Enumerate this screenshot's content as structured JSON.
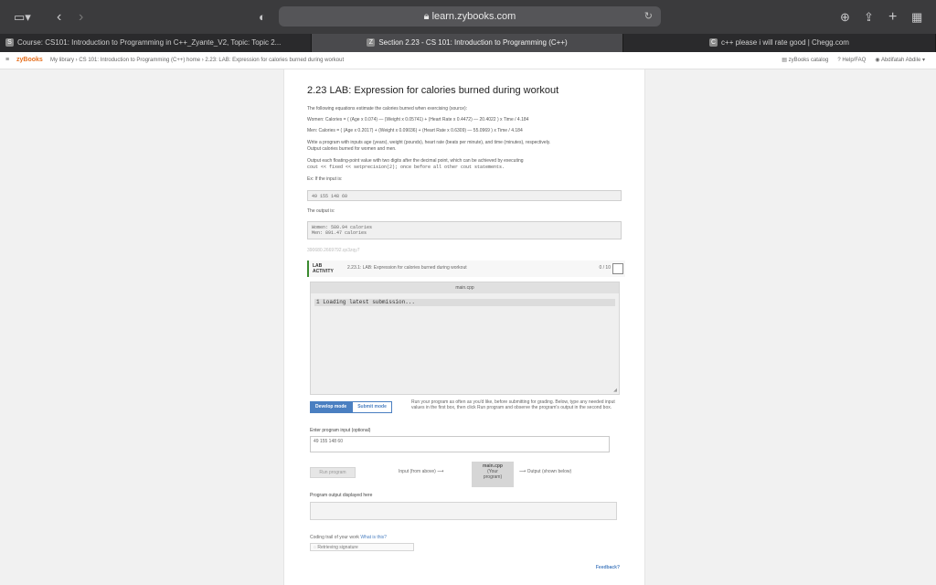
{
  "browser": {
    "address": "learn.zybooks.com",
    "tabs": [
      {
        "favicon": "S",
        "title": "Course: CS101: Introduction to Programming in C++_Zyante_V2, Topic: Topic 2..."
      },
      {
        "favicon": "Z",
        "title": "Section 2.23 - CS 101: Introduction to Programming (C++)"
      },
      {
        "favicon": "C",
        "title": "c++ please i will rate good | Chegg.com"
      }
    ]
  },
  "zybooks": {
    "logo": "zyBooks",
    "breadcrumb": "My library › CS 101: Introduction to Programming (C++) home › 2.23: LAB: Expression for calories burned during workout",
    "catalog": "zyBooks catalog",
    "help": "Help/FAQ",
    "user": "Abdifatah Abdile"
  },
  "content": {
    "title": "2.23 LAB: Expression for calories burned during workout",
    "intro": "The following equations estimate the calories burned when exercising (source):",
    "women_eq": "Women: Calories = ( (Age x 0.074) — (Weight x 0.05741) + (Heart Rate x 0.4472) — 20.4022 ) x Time / 4.184",
    "men_eq": "Men: Calories = ( (Age x 0.2017) + (Weight x 0.09036) + (Heart Rate x 0.6309) — 55.0969 ) x Time / 4.184",
    "task1": "Write a program with inputs age (years), weight (pounds), heart rate (beats per minute), and time (minutes), respectively.",
    "task2": "Output calories burned for women and men.",
    "task3": "Output each floating-point value with two digits after the decimal point, which can be achieved by executing",
    "task4": "cout << fixed << setprecision(2); once before all other cout statements.",
    "ex_in_label": "Ex: If the input is:",
    "ex_input": "49 155 148 60",
    "ex_out_label": "The output is:",
    "ex_output_1": "Women: 580.94 calories",
    "ex_output_2": "Men: 891.47 calories",
    "code_id": "390680.2669792.qx3zqy7"
  },
  "lab": {
    "tag_line1": "LAB",
    "tag_line2": "ACTIVITY",
    "name": "2.23.1: LAB: Expression for calories burned during workout",
    "score": "0 / 10",
    "file_tab": "main.cpp",
    "code_line": "1 Loading latest submission...",
    "develop_mode": "Develop mode",
    "submit_mode": "Submit mode",
    "mode_desc": "Run your program as often as you'd like, before submitting for grading. Below, type any needed input values in the first box, then click Run program and observe the program's output in the second box.",
    "input_label": "Enter program input (optional)",
    "input_value": "49 155 148 60",
    "run_button": "Run program",
    "flow_input": "Input (from above)",
    "flow_main_1": "main.cpp",
    "flow_main_2": "(Your",
    "flow_main_3": "program)",
    "flow_output": "Output (shown below)",
    "output_label": "Program output displayed here",
    "trail_label": "Coding trail of your work",
    "trail_link": "What is this?",
    "signature": "Retrieving signature",
    "feedback": "Feedback?"
  }
}
